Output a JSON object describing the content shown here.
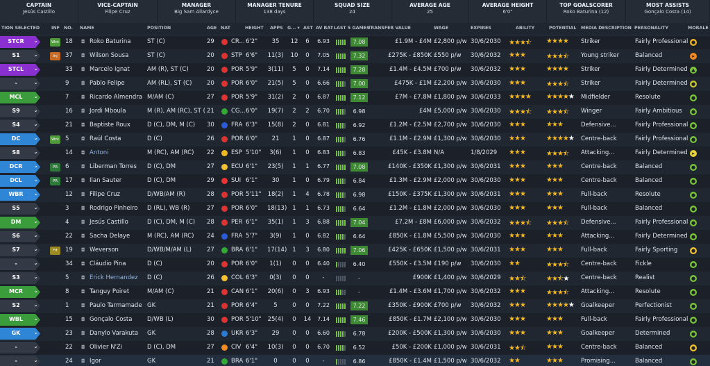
{
  "summary": [
    {
      "title": "CAPTAIN",
      "value": "Jesús Castillo"
    },
    {
      "title": "VICE-CAPTAIN",
      "value": "Filipe Cruz"
    },
    {
      "title": "MANAGER",
      "value": "Big Sam Allardyce"
    },
    {
      "title": "MANAGER TENURE",
      "value": "138 days"
    },
    {
      "title": "SQUAD SIZE",
      "value": "24"
    },
    {
      "title": "AVERAGE AGE",
      "value": "25"
    },
    {
      "title": "AVERAGE HEIGHT",
      "value": "6'0\""
    },
    {
      "title": "TOP GOALSCORER",
      "value": "Roko Baturina (12)"
    },
    {
      "title": "MOST ASSISTS",
      "value": "Gonçalo Costa (14)"
    }
  ],
  "columns": {
    "selected": "TION SELECTED",
    "inf": "INF",
    "no": "NO.",
    "name": "NAME",
    "position": "POSITION",
    "age": "AGE",
    "nat": "NAT",
    "height": "HEIGHT",
    "apps": "APPS",
    "gls": "G... ▾",
    "ast": "AST",
    "avrat": "AV RAT",
    "last5": "LAST 5 GAMES",
    "value": "TRANSFER VALUE",
    "wage": "WAGE",
    "expires": "EXPIRES",
    "ability": "ABILITY",
    "potential": "POTENTIAL",
    "media": "MEDIA DESCRIPTION",
    "personality": "PERSONALITY",
    "morale": "MORALE"
  },
  "colors": {
    "purple": "#8a2fd0",
    "blue": "#2f86d6",
    "green": "#3a9c3a",
    "grey": "#333a45"
  },
  "players": [
    {
      "role": "STCR",
      "rc": "purple",
      "chev": "⌄",
      "inf": "Wnt",
      "infc": "#4f9b3c",
      "no": "18",
      "name": "Roko Baturina",
      "pos": "ST (C)",
      "age": "29",
      "flag": "#d33",
      "nat": "CR...",
      "ht": "6'2\"",
      "apps": "35",
      "gls": "12",
      "ast": "6",
      "avr": "6.93",
      "form": 5,
      "avg": "7.08",
      "avgc": "#3d8a33",
      "value": "£1.9M - £4M",
      "wage": "£2,800 p/w",
      "exp": "30/6/2030",
      "ab": "3.5",
      "pot": "4",
      "pw": "0",
      "media": "Striker",
      "pers": "Fairly Professional",
      "mor": "#f2b724",
      "morg": "●"
    },
    {
      "role": "S1",
      "rc": "grey",
      "chev": "⌄",
      "inf": "Inj",
      "infc": "#c86a22",
      "no": "37",
      "name": "Wilson Sousa",
      "pos": "ST (C)",
      "age": "20",
      "flag": "#d33",
      "nat": "STP",
      "ht": "6'6\"",
      "apps": "11(3)",
      "gls": "10",
      "ast": "0",
      "avr": "7.05",
      "form": 5,
      "avg": "7.32",
      "avgc": "#3d8a33",
      "value": "£275K - £850K",
      "wage": "£550 p/w",
      "exp": "30/6/2032",
      "ab": "3",
      "pot": "3.5",
      "pw": "0",
      "media": "Young striker",
      "pers": "Balanced",
      "mor": "#f08a24",
      "morg": "▸"
    },
    {
      "role": "STCL",
      "rc": "purple",
      "chev": "⌄",
      "inf": "",
      "infc": "",
      "no": "33",
      "name": "Marcelo Ignat",
      "pos": "AM (R), ST (C)",
      "age": "20",
      "flag": "#d33",
      "nat": "POR",
      "ht": "5'9\"",
      "apps": "3(11)",
      "gls": "5",
      "ast": "0",
      "avr": "7.14",
      "form": 5,
      "avg": "7.28",
      "avgc": "#3d8a33",
      "value": "£1.4M - £4.5M",
      "wage": "£700 p/w",
      "exp": "30/6/2032",
      "ab": "3",
      "pot": "4",
      "pw": "0",
      "media": "Striker",
      "pers": "Fairly Determined",
      "mor": "#7ac43a",
      "morg": "▲"
    },
    {
      "role": "-",
      "rc": "grey",
      "chev": "⌄",
      "inf": "",
      "infc": "",
      "no": "9",
      "name": "Pablo Felipe",
      "pos": "AM (RL), ST (C)",
      "age": "20",
      "flag": "#d33",
      "nat": "POR",
      "ht": "6'0\"",
      "apps": "21(5)",
      "gls": "5",
      "ast": "0",
      "avr": "6.66",
      "form": 4,
      "avg": "7.00",
      "avgc": "#3d8a33",
      "value": "£475K - £1M",
      "wage": "£2,200 p/w",
      "exp": "30/6/2030",
      "ab": "3",
      "pot": "3.5",
      "pw": "0",
      "media": "Striker",
      "pers": "Fairly Determined",
      "mor": "#c8c832",
      "morg": "●"
    },
    {
      "role": "MCL",
      "rc": "green",
      "chev": "⌄",
      "inf": "",
      "infc": "",
      "no": "7",
      "name": "Ricardo Almendra",
      "pos": "M/AM (C)",
      "age": "27",
      "flag": "#d33",
      "nat": "POR",
      "ht": "5'9\"",
      "apps": "31(2)",
      "gls": "2",
      "ast": "0",
      "avr": "6.87",
      "form": 5,
      "avg": "7.12",
      "avgc": "#3d8a33",
      "value": "£7M - £7.8M",
      "wage": "£1,800 p/w",
      "exp": "30/6/2033",
      "ab": "4",
      "pot": "4",
      "pw": "1",
      "media": "Midfielder",
      "pers": "Resolute",
      "mor": "#7ac43a",
      "morg": "●"
    },
    {
      "role": "S9",
      "rc": "grey",
      "chev": "⌄",
      "inf": "",
      "infc": "",
      "no": "16",
      "name": "Jordi Mboula",
      "pos": "M (R), AM (RC), ST (C)",
      "age": "21",
      "flag": "#3a3",
      "nat": "CG...",
      "ht": "6'0\"",
      "apps": "19(7)",
      "gls": "2",
      "ast": "2",
      "avr": "6.70",
      "form": 4,
      "avg": "6.98",
      "avgc": "",
      "value": "£4M",
      "wage": "£5,000 p/w",
      "exp": "30/6/2030",
      "ab": "3.5",
      "pot": "3.5",
      "pw": "0",
      "media": "Winger",
      "pers": "Fairly Ambitious",
      "mor": "#7ac43a",
      "morg": "●"
    },
    {
      "role": "S4",
      "rc": "grey",
      "chev": "⌄",
      "inf": "",
      "infc": "",
      "no": "21",
      "name": "Baptiste Roux",
      "pos": "D (C), DM, M (C)",
      "age": "30",
      "flag": "#2a5bd6",
      "nat": "FRA",
      "ht": "6'3\"",
      "apps": "15(8)",
      "gls": "2",
      "ast": "0",
      "avr": "6.81",
      "form": 4,
      "avg": "6.92",
      "avgc": "",
      "value": "£1.2M - £2.5M",
      "wage": "£2,700 p/w",
      "exp": "30/6/2030",
      "ab": "3",
      "pot": "3",
      "pw": "0",
      "media": "Defensive...",
      "pers": "Fairly Professional",
      "mor": "#7ac43a",
      "morg": "●"
    },
    {
      "role": "DC",
      "rc": "blue",
      "chev": "⌄",
      "inf": "Wnt",
      "infc": "#4f9b3c",
      "no": "5",
      "name": "Raúl Costa",
      "pos": "D (C)",
      "age": "26",
      "flag": "#d33",
      "nat": "POR",
      "ht": "6'0\"",
      "apps": "21",
      "gls": "1",
      "ast": "0",
      "avr": "6.87",
      "form": 4,
      "avg": "6.76",
      "avgc": "",
      "value": "£1.1M - £2.9M",
      "wage": "£1,300 p/w",
      "exp": "30/6/2030",
      "ab": "3",
      "pot": "4",
      "pw": "1",
      "media": "Centre-back",
      "pers": "Fairly Professional",
      "mor": "#7ac43a",
      "morg": "●"
    },
    {
      "role": "S8",
      "rc": "grey",
      "chev": "⌄",
      "inf": "",
      "infc": "",
      "no": "14",
      "name": "Antoni",
      "pos": "M (RC), AM (RC)",
      "age": "22",
      "flag": "#f2b724",
      "nat": "ESP",
      "ht": "5'10\"",
      "apps": "3(6)",
      "gls": "1",
      "ast": "0",
      "avr": "6.83",
      "form": 4,
      "avg": "6.83",
      "avgc": "",
      "value": "£45K - £3.8M",
      "wage": "N/A",
      "exp": "1/8/2029",
      "ab": "3",
      "pot": "3.5",
      "pw": "0",
      "media": "Attacking...",
      "pers": "Fairly Determined",
      "mor": "#e6d23a",
      "morg": "▸",
      "loan": true
    },
    {
      "role": "DCR",
      "rc": "blue",
      "chev": "⌄",
      "inf": "PR",
      "infc": "#2e7a3a",
      "no": "6",
      "name": "Liberman Torres",
      "pos": "D (C), DM",
      "age": "27",
      "flag": "#f2c230",
      "nat": "ECU",
      "ht": "6'1\"",
      "apps": "23(5)",
      "gls": "1",
      "ast": "1",
      "avr": "6.77",
      "form": 5,
      "avg": "7.08",
      "avgc": "#3d8a33",
      "value": "£140K - £350K",
      "wage": "£1,300 p/w",
      "exp": "30/6/2031",
      "ab": "3",
      "pot": "3",
      "pw": "0",
      "media": "Centre-back",
      "pers": "Balanced",
      "mor": "#7ac43a",
      "morg": "●"
    },
    {
      "role": "DCL",
      "rc": "blue",
      "chev": "⌄",
      "inf": "PR",
      "infc": "#2e7a3a",
      "no": "17",
      "name": "Ilan Sauter",
      "pos": "D (C), DM",
      "age": "29",
      "flag": "#e33",
      "nat": "SUI",
      "ht": "6'1\"",
      "apps": "30",
      "gls": "1",
      "ast": "0",
      "avr": "6.79",
      "form": 4,
      "avg": "6.84",
      "avgc": "",
      "value": "£1.3M - £2.9M",
      "wage": "£2,000 p/w",
      "exp": "30/6/2030",
      "ab": "3",
      "pot": "3",
      "pw": "0",
      "media": "Centre-back",
      "pers": "Balanced",
      "mor": "#7ac43a",
      "morg": "●"
    },
    {
      "role": "WBR",
      "rc": "blue",
      "chev": "⌄",
      "inf": "",
      "infc": "",
      "no": "12",
      "name": "Filipe Cruz",
      "pos": "D/WB/AM (R)",
      "age": "28",
      "flag": "#d33",
      "nat": "POR",
      "ht": "5'11\"",
      "apps": "18(2)",
      "gls": "1",
      "ast": "4",
      "avr": "6.78",
      "form": 4,
      "avg": "6.98",
      "avgc": "",
      "value": "£150K - £375K",
      "wage": "£1,300 p/w",
      "exp": "30/6/2031",
      "ab": "3",
      "pot": "3",
      "pw": "0",
      "media": "Full-back",
      "pers": "Resolute",
      "mor": "#7ac43a",
      "morg": "●"
    },
    {
      "role": "S5",
      "rc": "grey",
      "chev": "⌄",
      "inf": "",
      "infc": "",
      "no": "3",
      "name": "Rodrigo Pinheiro",
      "pos": "D (RL), WB (R)",
      "age": "27",
      "flag": "#d33",
      "nat": "POR",
      "ht": "6'0\"",
      "apps": "18(13)",
      "gls": "1",
      "ast": "1",
      "avr": "6.73",
      "form": 4,
      "avg": "6.64",
      "avgc": "",
      "value": "£1.2M - £1.8M",
      "wage": "£2,000 p/w",
      "exp": "30/6/2030",
      "ab": "3",
      "pot": "3",
      "pw": "0",
      "media": "Full-back",
      "pers": "Balanced",
      "mor": "#7ac43a",
      "morg": "●"
    },
    {
      "role": "DM",
      "rc": "green",
      "chev": "⌄",
      "inf": "",
      "infc": "",
      "no": "4",
      "name": "Jesús Castillo",
      "pos": "D (C), DM, M (C)",
      "age": "28",
      "flag": "#d33",
      "nat": "PER",
      "ht": "6'1\"",
      "apps": "35(1)",
      "gls": "1",
      "ast": "3",
      "avr": "6.88",
      "form": 5,
      "avg": "7.04",
      "avgc": "#3d8a33",
      "value": "£7.2M - £8M",
      "wage": "£6,000 p/w",
      "exp": "30/6/2032",
      "ab": "3.5",
      "pot": "3.5",
      "pw": "0",
      "media": "Defensive...",
      "pers": "Fairly Professional",
      "mor": "#7ac43a",
      "morg": "●"
    },
    {
      "role": "S6",
      "rc": "grey",
      "chev": "⌄",
      "inf": "",
      "infc": "",
      "no": "22",
      "name": "Sacha Delaye",
      "pos": "M (RC), AM (RC)",
      "age": "24",
      "flag": "#2a5bd6",
      "nat": "FRA",
      "ht": "5'7\"",
      "apps": "3(9)",
      "gls": "1",
      "ast": "0",
      "avr": "6.82",
      "form": 4,
      "avg": "6.64",
      "avgc": "",
      "value": "£850K - £1.8M",
      "wage": "£5,500 p/w",
      "exp": "30/6/2030",
      "ab": "3",
      "pot": "3",
      "pw": "0",
      "media": "Attacking...",
      "pers": "Fairly Determined",
      "mor": "#7ac43a",
      "morg": "●"
    },
    {
      "role": "S7",
      "rc": "grey",
      "chev": "⌄",
      "inf": "Frt",
      "infc": "#9b8a22",
      "no": "19",
      "name": "Weverson",
      "pos": "D/WB/M/AM (L)",
      "age": "27",
      "flag": "#3a3",
      "nat": "BRA",
      "ht": "6'1\"",
      "apps": "17(14)",
      "gls": "1",
      "ast": "3",
      "avr": "6.80",
      "form": 5,
      "avg": "7.06",
      "avgc": "#3d8a33",
      "value": "£425K - £650K",
      "wage": "£1,500 p/w",
      "exp": "30/6/2031",
      "ab": "3",
      "pot": "3",
      "pw": "0",
      "media": "Full-back",
      "pers": "Fairly Sporting",
      "mor": "#f2c230",
      "morg": "●"
    },
    {
      "role": "-",
      "rc": "grey",
      "chev": "⌄",
      "inf": "",
      "infc": "",
      "no": "34",
      "name": "Cláudio Pina",
      "pos": "D (C)",
      "age": "20",
      "flag": "#d33",
      "nat": "POR",
      "ht": "6'0\"",
      "apps": "1(1)",
      "gls": "0",
      "ast": "0",
      "avr": "6.40",
      "form": 1,
      "avg": "6.40",
      "avgc": "",
      "value": "£550K - £3.5M",
      "wage": "£190 p/w",
      "exp": "30/6/2030",
      "ab": "2",
      "pot": "3.5",
      "pw": "0",
      "media": "Centre-back",
      "pers": "Fickle",
      "mor": "#7ac43a",
      "morg": "●"
    },
    {
      "role": "S3",
      "rc": "grey",
      "chev": "⌄",
      "inf": "",
      "infc": "",
      "no": "5",
      "name": "Erick Hernandez",
      "pos": "D (C)",
      "age": "26",
      "flag": "#f2c230",
      "nat": "COL",
      "ht": "6'3\"",
      "apps": "0(3)",
      "gls": "0",
      "ast": "0",
      "avr": "-",
      "form": 0,
      "avg": "-",
      "avgc": "",
      "value": "£900K",
      "wage": "£1,400 p/w",
      "exp": "30/6/2029",
      "ab": "2.5",
      "pot": "2.5",
      "pw": "1",
      "media": "Centre-back",
      "pers": "Realist",
      "mor": "#7ac43a",
      "morg": "●",
      "loan": true
    },
    {
      "role": "MCR",
      "rc": "green",
      "chev": "⌄",
      "inf": "",
      "infc": "",
      "no": "8",
      "name": "Tanguy Poiret",
      "pos": "M/AM (C)",
      "age": "21",
      "flag": "#d33",
      "nat": "CAN",
      "ht": "6'1\"",
      "apps": "20(6)",
      "gls": "0",
      "ast": "3",
      "avr": "6.93",
      "form": 3,
      "avg": "-",
      "avgc": "",
      "value": "£1.4M - £3.6M",
      "wage": "£1,700 p/w",
      "exp": "30/6/2032",
      "ab": "3",
      "pot": "3.5",
      "pw": "0",
      "media": "Attacking...",
      "pers": "Resolute",
      "mor": "#7ac43a",
      "morg": "●"
    },
    {
      "role": "S2",
      "rc": "grey",
      "chev": "⌄",
      "inf": "",
      "infc": "",
      "no": "1",
      "name": "Paulo Tarmamade",
      "pos": "GK",
      "age": "21",
      "flag": "#d33",
      "nat": "POR",
      "ht": "6'4\"",
      "apps": "5",
      "gls": "0",
      "ast": "0",
      "avr": "7.22",
      "form": 5,
      "avg": "7.22",
      "avgc": "#3d8a33",
      "value": "£350K - £900K",
      "wage": "£700 p/w",
      "exp": "30/6/2032",
      "ab": "3",
      "pot": "4",
      "pw": "1",
      "media": "Goalkeeper",
      "pers": "Perfectionist",
      "mor": "#7ac43a",
      "morg": "●"
    },
    {
      "role": "WBL",
      "rc": "green",
      "chev": "⌄",
      "inf": "",
      "infc": "",
      "no": "15",
      "name": "Gonçalo Costa",
      "pos": "D/WB (L)",
      "age": "30",
      "flag": "#d33",
      "nat": "POR",
      "ht": "5'10\"",
      "apps": "25(4)",
      "gls": "0",
      "ast": "14",
      "avr": "7.14",
      "form": 5,
      "avg": "7.46",
      "avgc": "#3d8a33",
      "value": "£850K - £1.7M",
      "wage": "£2,100 p/w",
      "exp": "30/6/2030",
      "ab": "3",
      "pot": "3",
      "pw": "0",
      "media": "Full-back",
      "pers": "Fairly Professional",
      "mor": "#7ac43a",
      "morg": "●"
    },
    {
      "role": "GK",
      "rc": "blue",
      "chev": "⌄",
      "inf": "",
      "infc": "",
      "no": "23",
      "name": "Danylo Varakuta",
      "pos": "GK",
      "age": "28",
      "flag": "#2a7bd6",
      "nat": "UKR",
      "ht": "6'3\"",
      "apps": "29",
      "gls": "0",
      "ast": "0",
      "avr": "6.60",
      "form": 4,
      "avg": "6.78",
      "avgc": "",
      "value": "£200K - £500K",
      "wage": "£1,300 p/w",
      "exp": "30/6/2030",
      "ab": "3",
      "pot": "3",
      "pw": "0",
      "media": "Goalkeeper",
      "pers": "Determined",
      "mor": "#7ac43a",
      "morg": "●"
    },
    {
      "role": "-",
      "rc": "grey",
      "chev": "⌄",
      "inf": "",
      "infc": "",
      "no": "22",
      "name": "Olivier N'Zi",
      "pos": "D (C), DM",
      "age": "27",
      "flag": "#f08a24",
      "nat": "CIV",
      "ht": "6'4\"",
      "apps": "10(3)",
      "gls": "0",
      "ast": "0",
      "avr": "6.70",
      "form": 4,
      "avg": "6.52",
      "avgc": "",
      "value": "£50K - £200K",
      "wage": "£1,000 p/w",
      "exp": "30/6/2031",
      "ab": "2.5",
      "pot": "3",
      "pw": "0",
      "media": "Centre-back",
      "pers": "Balanced",
      "mor": "#f2c230",
      "morg": "●"
    },
    {
      "role": "-",
      "rc": "grey",
      "chev": "⌄",
      "inf": "",
      "infc": "",
      "no": "24",
      "name": "Igor",
      "pos": "GK",
      "age": "21",
      "flag": "#3a3",
      "nat": "BRA",
      "ht": "6'1\"",
      "apps": "0",
      "gls": "0",
      "ast": "0",
      "avr": "-",
      "form": 1,
      "avg": "6.86",
      "avgc": "",
      "value": "£850K - £1.4M",
      "wage": "£1,500 p/w",
      "exp": "30/6/2032",
      "ab": "2",
      "pot": "3",
      "pw": "0",
      "media": "Promising...",
      "pers": "Balanced",
      "mor": "#7ac43a",
      "morg": "●",
      "sel": true
    }
  ]
}
